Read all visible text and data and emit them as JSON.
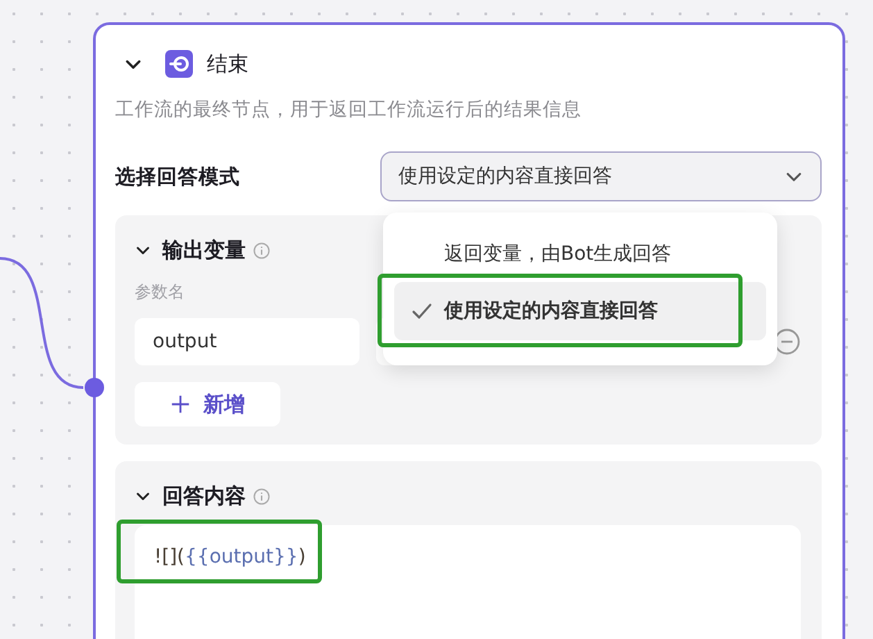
{
  "node": {
    "title": "结束",
    "expanded": true,
    "description": "工作流的最终节点，用于返回工作流运行后的结果信息"
  },
  "answer_mode": {
    "label": "选择回答模式",
    "value": "使用设定的内容直接回答",
    "options": [
      {
        "label": "返回变量，由Bot生成回答",
        "selected": false
      },
      {
        "label": "使用设定的内容直接回答",
        "selected": true
      }
    ]
  },
  "output_variables": {
    "title": "输出变量",
    "expanded": true,
    "column_label": "参数名",
    "rows": [
      {
        "name": "output"
      }
    ],
    "add_button": "新增"
  },
  "answer_content": {
    "title": "回答内容",
    "expanded": true,
    "segments": [
      {
        "text": "![](",
        "kind": "plain"
      },
      {
        "text": "{{output}}",
        "kind": "variable"
      },
      {
        "text": ")",
        "kind": "plain"
      }
    ]
  }
}
